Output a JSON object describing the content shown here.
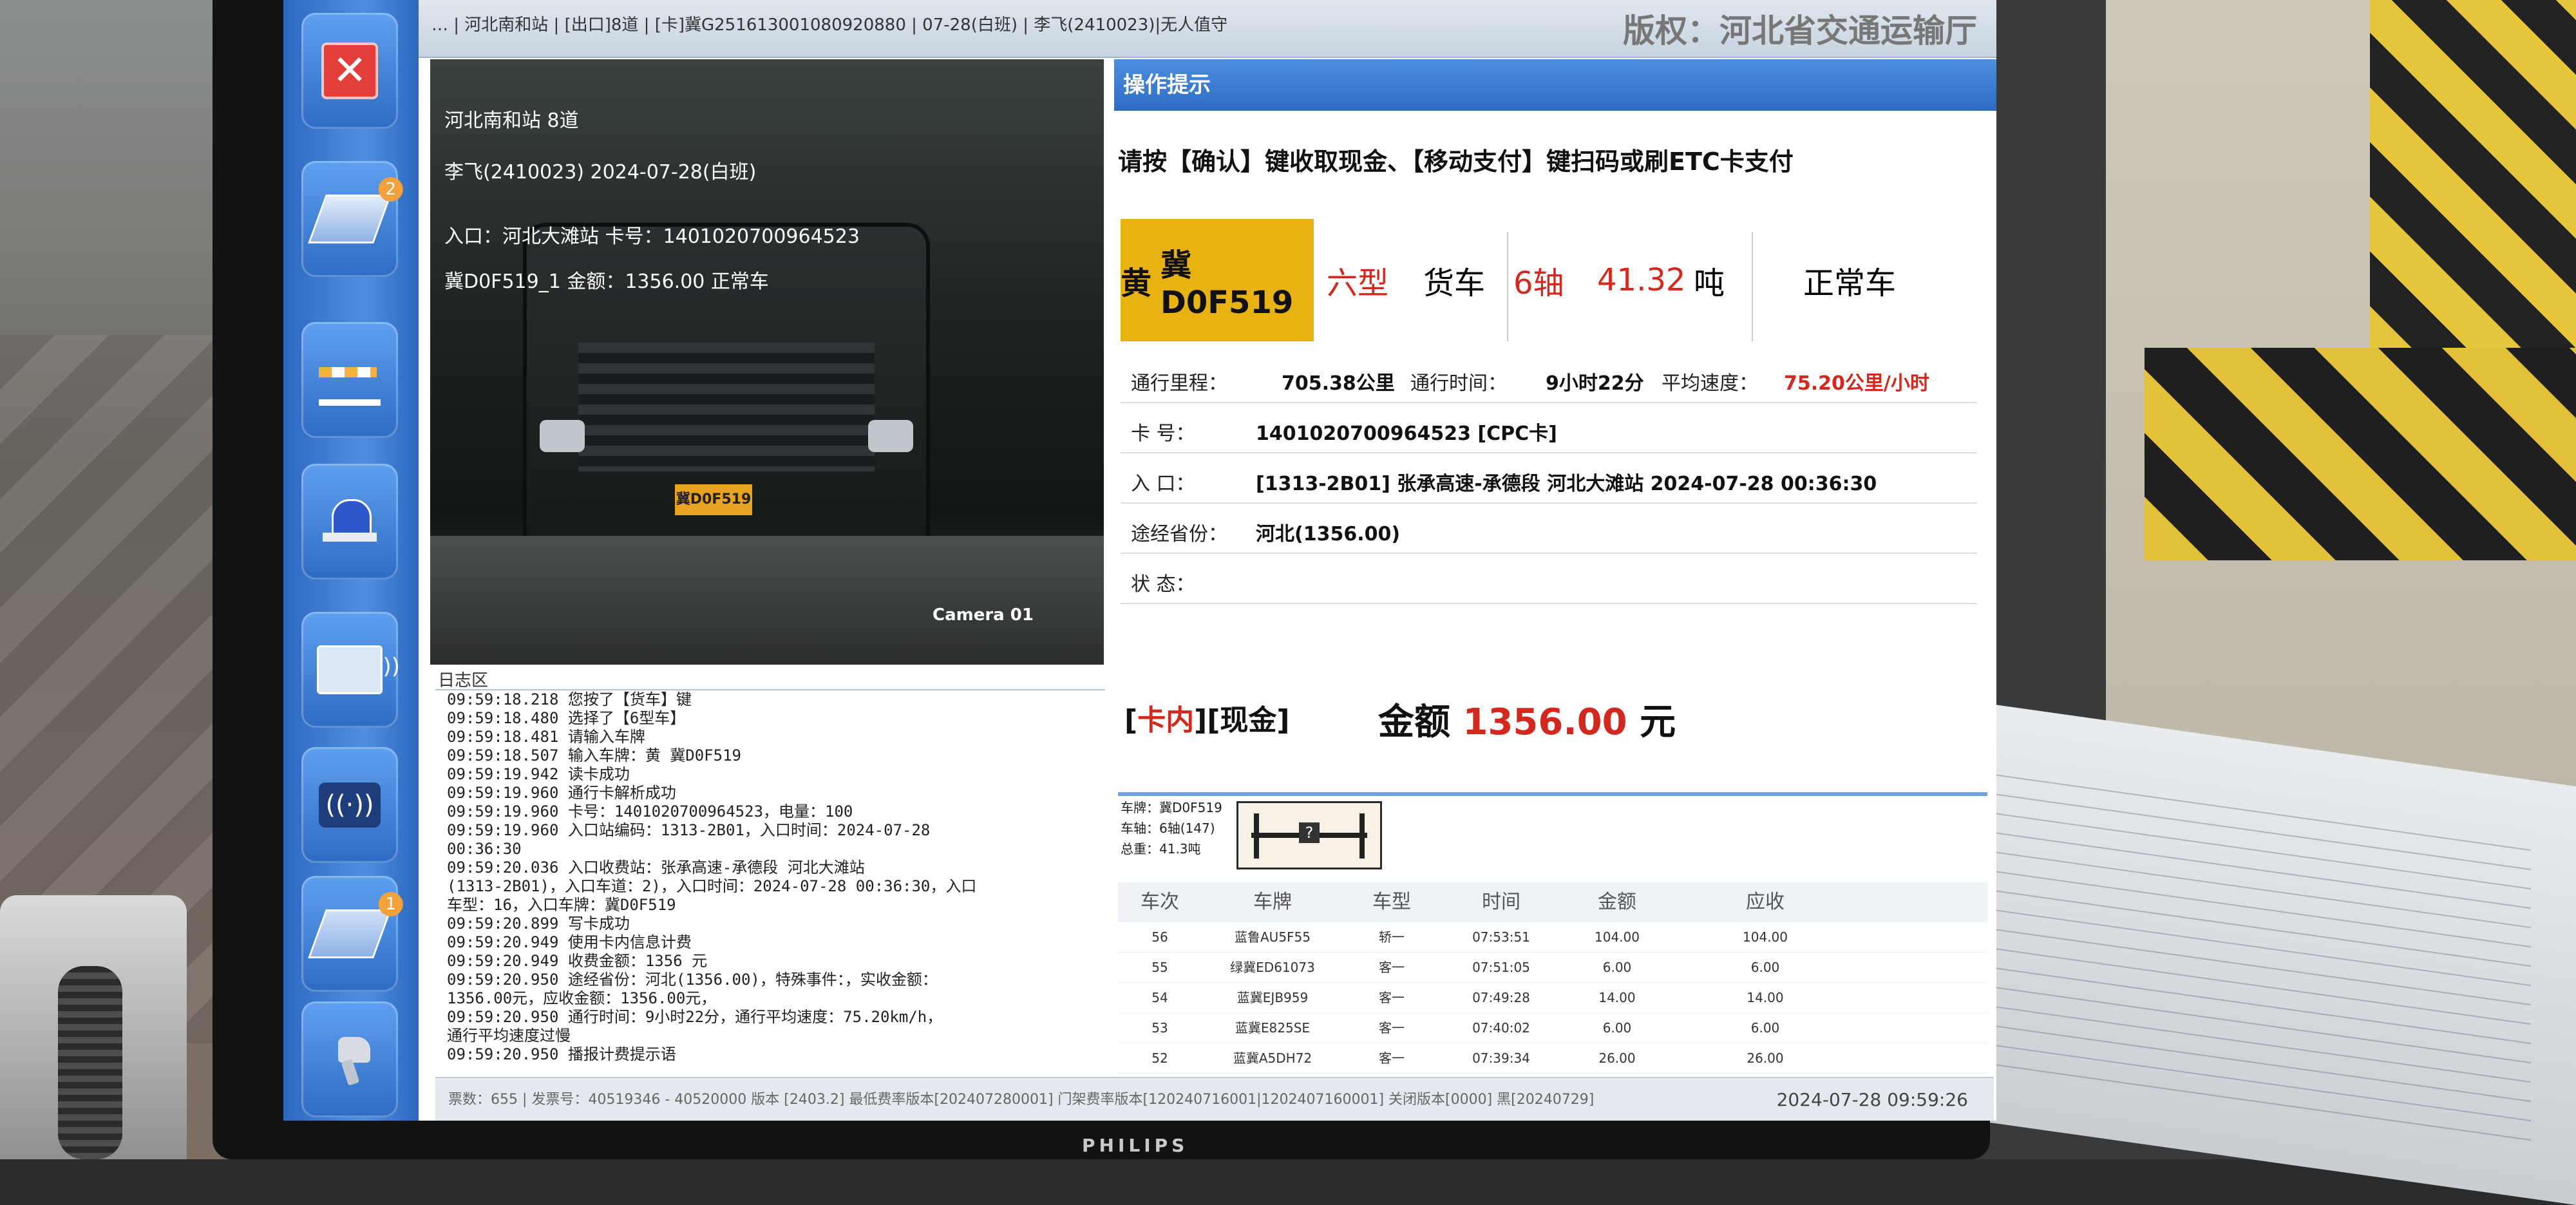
{
  "topbar": {
    "info": "… | 河北南和站 | [出口]8道 | [卡]冀G2516130010809208​80 | 07-28(白班) | 李飞(2410023)|无人值守",
    "copyright": "版权：河北省交通运输厅"
  },
  "toolbar": {
    "badges": {
      "plate_count": "2",
      "car_count": "1"
    },
    "icons": [
      "close-icon",
      "plate-icon",
      "barrier-icon",
      "alarm-light-icon",
      "card-reader-icon",
      "etc-icon",
      "vehicle-icon",
      "scanner-icon"
    ]
  },
  "camera": {
    "osd_lines": [
      "河北南和站 8道",
      "李飞(2410023) 2024-07-28(白班)",
      "入口：河北大滩站 卡号：1401020700964523",
      "冀D0F519_1 金额：1356.00 正常车"
    ],
    "plate": "冀D0F519",
    "label": "Camera 01"
  },
  "log": {
    "title": "日志区",
    "lines": [
      "09:59:18.218 您按了【货车】键",
      "09:59:18.480 选择了【6型车】",
      "09:59:18.481 请输入车牌",
      "09:59:18.507 输入车牌：黄 冀D0F519",
      "09:59:19.942 读卡成功",
      "09:59:19.960 通行卡解析成功",
      "09:59:19.960 卡号：1401020700964523，电量：100",
      "09:59:19.960 入口站编码：1313-2B01，入口时间：2024-07-28",
      "00:36:30",
      "09:59:20.036 入口收费站：张承高速-承德段 河北大滩站",
      "(1313-2B01)，入口车道：2)，入口时间：2024-07-28 00:36:30，入口",
      "车型：16，入口车牌：冀D0F519",
      "09:59:20.899 写卡成功",
      "09:59:20.949 使用卡内信息计费",
      "09:59:20.949 收费金额：1356 元",
      "09:59:20.950 途经省份：河北(1356.00)，特殊事件：，实收金额：",
      "1356.00元，应收金额：1356.00元，",
      "09:59:20.950 通行时间：9小时22分，通行平均速度：75.20km/h，",
      "通行平均速度过慢",
      "09:59:20.950 播报计费提示语"
    ]
  },
  "op": {
    "header": "操作提示",
    "hint": "请按【确认】键收取现金、【移动支付】键扫码或刷ETC卡支付"
  },
  "vehicle": {
    "plate_color": "黄",
    "plate": "冀D0F519",
    "vehicle_class": "六型",
    "vehicle_kind": "货车",
    "axles": "6轴",
    "weight": "41.32",
    "weight_unit": "吨",
    "status": "正常车"
  },
  "trip": {
    "mileage_label": "通行里程：",
    "mileage": "705.38公里",
    "time_label": "通行时间：",
    "time": "9小时22分",
    "speed_label": "平均速度：",
    "speed": "75.20公里/小时",
    "card_label": "卡    号：",
    "card": "1401020700964523 [CPC卡]",
    "entry_label": "入    口：",
    "entry": "[1313-2B01] 张承高速-承德段 河北大滩站 2024-07-28 00:36:30",
    "province_label": "途经省份：",
    "province": "河北(1356.00)",
    "state_label": "状    态：",
    "state": ""
  },
  "payment": {
    "mode_open": "[",
    "mode_card": "卡内",
    "mode_close": "][现金]",
    "amount_label": "金额",
    "amount": "1356.00",
    "unit": "元"
  },
  "mini": {
    "plate": "车牌：冀D0F519",
    "axle": "车轴：6轴(147)",
    "weight": "总重：41.3吨"
  },
  "records": {
    "headers": [
      "车次",
      "车牌",
      "车型",
      "时间",
      "金额",
      "应收"
    ],
    "rows": [
      [
        "56",
        "蓝鲁AU5F55",
        "轿一",
        "07:53:51",
        "104.00",
        "104.00"
      ],
      [
        "55",
        "绿冀ED61073",
        "客一",
        "07:51:05",
        "6.00",
        "6.00"
      ],
      [
        "54",
        "蓝冀EJB959",
        "客一",
        "07:49:28",
        "14.00",
        "14.00"
      ],
      [
        "53",
        "蓝冀E825SE",
        "客一",
        "07:40:02",
        "6.00",
        "6.00"
      ],
      [
        "52",
        "蓝冀A5DH72",
        "客一",
        "07:39:34",
        "26.00",
        "26.00"
      ]
    ]
  },
  "status": {
    "text": "票数：655 | 发票号：40519346 - 40520000 版本 [2403.2] 最低费率版本[202407280001] 门架费率版本[120240716001|1202407160001] 关闭版本[0000] 黑[20240729]",
    "time": "2024-07-28 09:59:26"
  },
  "colors": {
    "accent": "#2d6cc3",
    "plate_yellow": "#e8b213",
    "amount_red": "#d2281e"
  }
}
